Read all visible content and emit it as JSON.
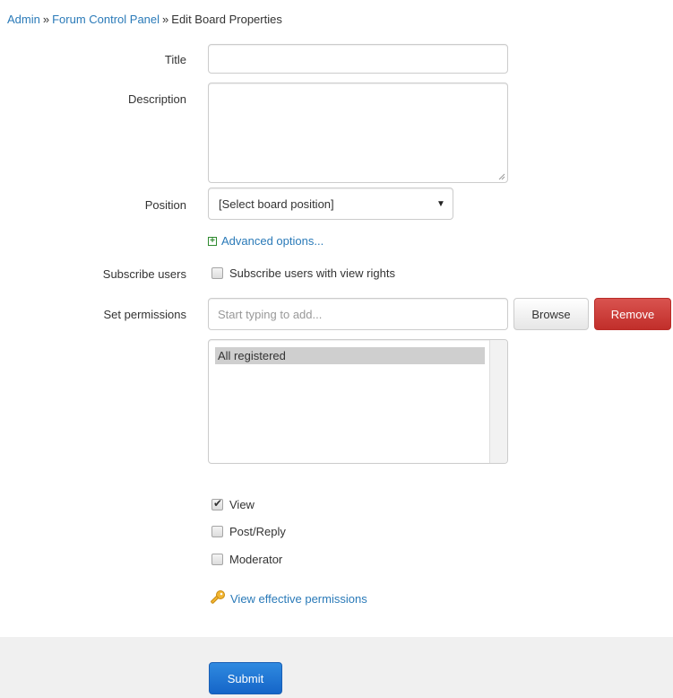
{
  "breadcrumb": {
    "items": [
      {
        "label": "Admin"
      },
      {
        "label": "Forum Control Panel"
      },
      {
        "label": "Edit Board Properties"
      }
    ],
    "separator": "»"
  },
  "form": {
    "title": {
      "label": "Title",
      "value": ""
    },
    "description": {
      "label": "Description",
      "value": ""
    },
    "position": {
      "label": "Position",
      "selected": "[Select board position]"
    },
    "advanced": {
      "label": "Advanced options...",
      "icon": "plus-box-icon"
    },
    "subscribe": {
      "label": "Subscribe users",
      "checkbox_label": "Subscribe users with view rights",
      "checked": false
    },
    "permissions": {
      "label": "Set permissions",
      "placeholder": "Start typing to add...",
      "browse_label": "Browse",
      "remove_label": "Remove",
      "list_items": [
        "All registered"
      ],
      "rights": [
        {
          "label": "View",
          "checked": true
        },
        {
          "label": "Post/Reply",
          "checked": false
        },
        {
          "label": "Moderator",
          "checked": false
        }
      ],
      "effective_link": "View effective permissions",
      "effective_icon": "key-icon"
    }
  },
  "footer": {
    "submit_label": "Submit"
  },
  "colors": {
    "link": "#2a7ab8",
    "remove_button": "#d9534f",
    "submit_button": "#1a75d2",
    "footer_bg": "#f0f0f0"
  }
}
